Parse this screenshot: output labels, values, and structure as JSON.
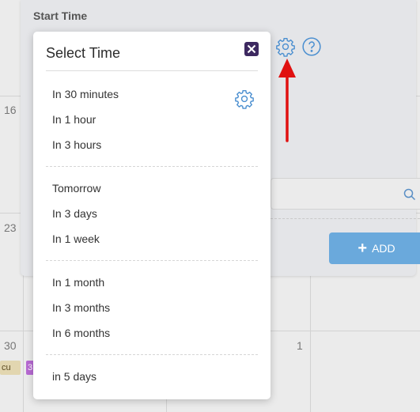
{
  "calendar": {
    "day_numbers": [
      "16",
      "23",
      "30",
      "1"
    ],
    "events": [
      {
        "label": "cu",
        "color": "#e2d6b0"
      },
      {
        "label": "3",
        "color": "#b76ad3"
      }
    ]
  },
  "panel": {
    "title": "Start Time",
    "settings_icon": "gear-icon",
    "help_icon": "question-circle-icon",
    "search_icon": "search-icon",
    "add_label": "ADD",
    "add_icon": "plus-icon"
  },
  "popup": {
    "title": "Select Time",
    "close_icon": "close-x-icon",
    "gear_icon": "gear-icon",
    "groups": [
      [
        "In 30 minutes",
        "In 1 hour",
        "In 3 hours"
      ],
      [
        "Tomorrow",
        "In 3 days",
        "In 1 week"
      ],
      [
        "In 1 month",
        "In 3 months",
        "In 6 months"
      ],
      [
        "in 5 days"
      ]
    ]
  },
  "annotation": {
    "arrow_color": "#e01010"
  }
}
